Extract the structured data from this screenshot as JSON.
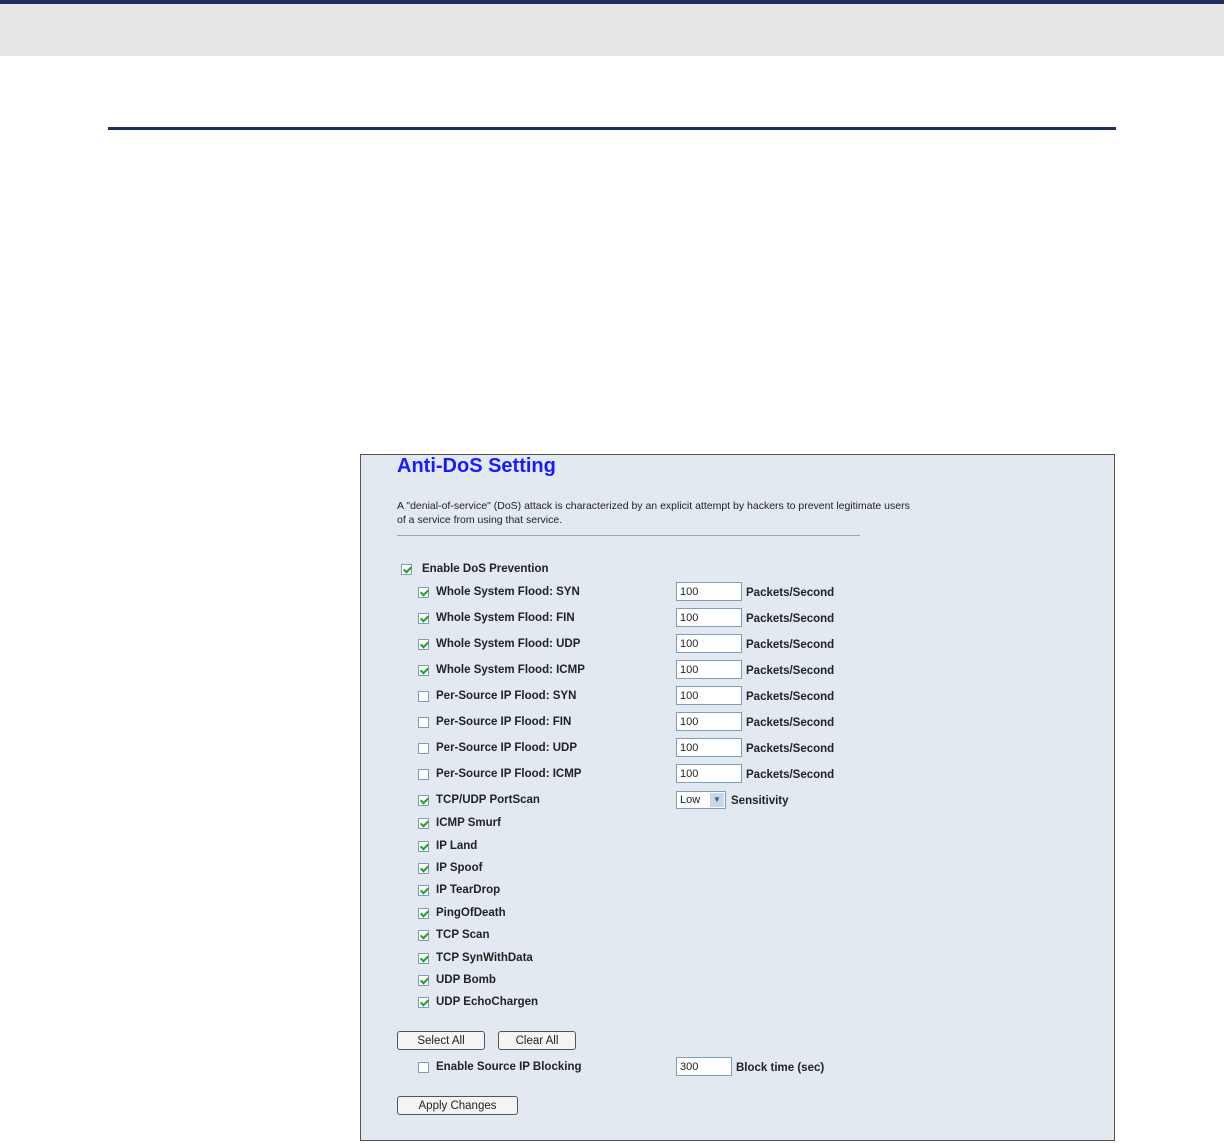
{
  "panel": {
    "title": "Anti-DoS Setting",
    "description": "A \"denial-of-service\" (DoS) attack is characterized by an explicit attempt by hackers to prevent legitimate users of a service from using that service."
  },
  "enable_dos": {
    "label": "Enable DoS Prevention",
    "checked": true
  },
  "flood_rows": [
    {
      "label": "Whole System Flood: SYN",
      "checked": true,
      "value": "100",
      "unit": "Packets/Second"
    },
    {
      "label": "Whole System Flood: FIN",
      "checked": true,
      "value": "100",
      "unit": "Packets/Second"
    },
    {
      "label": "Whole System Flood: UDP",
      "checked": true,
      "value": "100",
      "unit": "Packets/Second"
    },
    {
      "label": "Whole System Flood: ICMP",
      "checked": true,
      "value": "100",
      "unit": "Packets/Second"
    },
    {
      "label": "Per-Source IP Flood: SYN",
      "checked": false,
      "value": "100",
      "unit": "Packets/Second"
    },
    {
      "label": "Per-Source IP Flood: FIN",
      "checked": false,
      "value": "100",
      "unit": "Packets/Second"
    },
    {
      "label": "Per-Source IP Flood: UDP",
      "checked": false,
      "value": "100",
      "unit": "Packets/Second"
    },
    {
      "label": "Per-Source IP Flood: ICMP",
      "checked": false,
      "value": "100",
      "unit": "Packets/Second"
    }
  ],
  "portscan": {
    "label": "TCP/UDP PortScan",
    "checked": true,
    "selected": "Low",
    "unit": "Sensitivity"
  },
  "simple_rows": [
    {
      "label": "ICMP Smurf",
      "checked": true
    },
    {
      "label": "IP Land",
      "checked": true
    },
    {
      "label": "IP Spoof",
      "checked": true
    },
    {
      "label": "IP TearDrop",
      "checked": true
    },
    {
      "label": "PingOfDeath",
      "checked": true
    },
    {
      "label": "TCP Scan",
      "checked": true
    },
    {
      "label": "TCP SynWithData",
      "checked": true
    },
    {
      "label": "UDP Bomb",
      "checked": true
    },
    {
      "label": "UDP EchoChargen",
      "checked": true
    }
  ],
  "buttons": {
    "select_all": "Select All",
    "clear_all": "Clear All",
    "apply": "Apply Changes"
  },
  "source_ip_blocking": {
    "label": "Enable Source IP Blocking",
    "checked": false,
    "value": "300",
    "unit": "Block time (sec)"
  }
}
